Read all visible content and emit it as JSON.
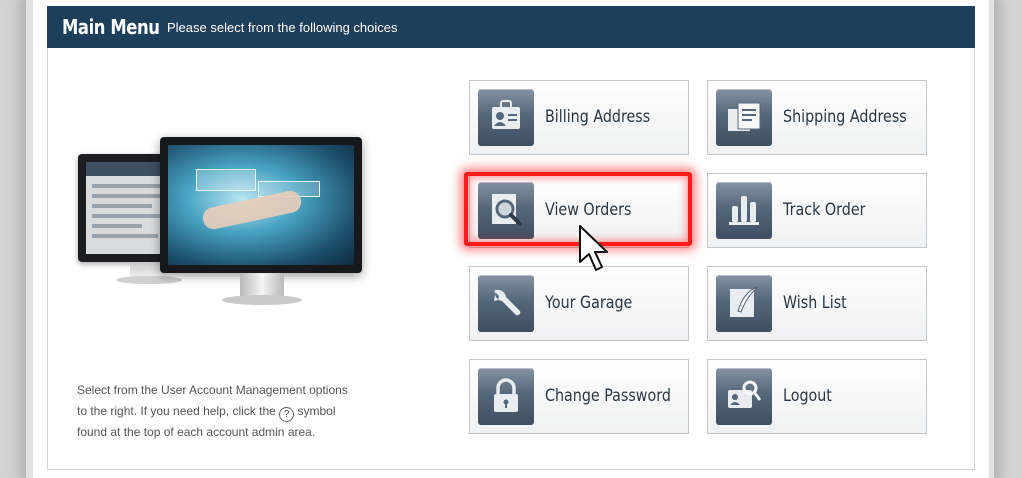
{
  "header": {
    "title": "Main Menu",
    "subtitle": "Please select from the following choices"
  },
  "help": {
    "text_before": "Select from the User Account Management options to the right. If you need help, click the",
    "help_icon": "?",
    "text_after": "symbol found at the top of each account admin area."
  },
  "tiles": [
    {
      "label": "Billing Address",
      "icon": "id-badge-icon"
    },
    {
      "label": "Shipping Address",
      "icon": "boxes-icon"
    },
    {
      "label": "View Orders",
      "icon": "magnifier-document-icon"
    },
    {
      "label": "Track Order",
      "icon": "bar-chart-icon"
    },
    {
      "label": "Your Garage",
      "icon": "wrench-icon"
    },
    {
      "label": "Wish List",
      "icon": "quill-note-icon"
    },
    {
      "label": "Change Password",
      "icon": "padlock-icon"
    },
    {
      "label": "Logout",
      "icon": "key-card-icon"
    }
  ],
  "colors": {
    "header_bg": "#1e3f5c",
    "highlight": "#ff1a1a",
    "icon_bg": "#55677a"
  }
}
